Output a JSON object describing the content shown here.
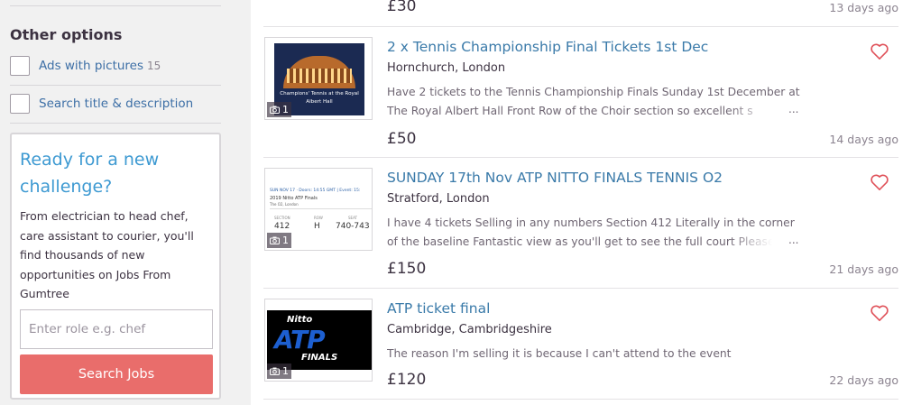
{
  "sidebar": {
    "heading": "Other options",
    "options": [
      {
        "label": "Ads with pictures",
        "count": "15"
      },
      {
        "label": "Search title & description",
        "count": ""
      }
    ],
    "promo": {
      "title": "Ready for a new challenge?",
      "body": "From electrician to head chef, care assistant to courier, you'll find thousands of new opportunities on Jobs From Gumtree",
      "input_placeholder": "Enter role e.g. chef",
      "button_label": "Search Jobs",
      "accent_color": "#3e9ad2",
      "button_color": "#e96d6b"
    }
  },
  "previous": {
    "price": "£30",
    "age": "13 days ago"
  },
  "listings": [
    {
      "title": "2 x Tennis Championship Final Tickets 1st Dec",
      "location": "Hornchurch, London",
      "description": "Have 2 tickets to the Tennis Championship Finals Sunday 1st December at The Royal Albert Hall Front Row of the Choir section so excellent s",
      "ellipsis": "...",
      "price": "£50",
      "age": "14 days ago",
      "photo_count": "1",
      "thumb_caption": "Champions' Tennis at the Royal Albert Hall"
    },
    {
      "title": "SUNDAY 17th Nov ATP NITTO FINALS TENNIS O2",
      "location": "Stratford, London",
      "description": "I have 4 tickets Selling in any numbers Section 412 Literally in the corner of the baseline Fantastic view as you'll get to see the full court Please",
      "ellipsis": "...",
      "price": "£150",
      "age": "21 days ago",
      "photo_count": "1",
      "thumb": {
        "line1": "SUN NOV 17 · Doors: 14:55 GMT | Event: 15:",
        "line2": "2019 Nitto ATP Finals",
        "line3": "The O2, London",
        "headers": [
          "SECTION",
          "ROW",
          "SEAT"
        ],
        "values": [
          "412",
          "H",
          "740-743"
        ]
      }
    },
    {
      "title": "ATP ticket final",
      "location": "Cambridge, Cambridgeshire",
      "description": "The reason I'm selling it is because I can't attend to the event",
      "ellipsis": "",
      "price": "£120",
      "age": "22 days ago",
      "photo_count": "1",
      "thumb": {
        "brand": "Nitto",
        "logo": "ATP",
        "sub": "FINALS"
      }
    }
  ],
  "icons": {
    "favourite": "heart-outline-icon",
    "photos": "camera-icon"
  },
  "colors": {
    "link": "#3a7aa9",
    "heart": "#e0525a"
  }
}
